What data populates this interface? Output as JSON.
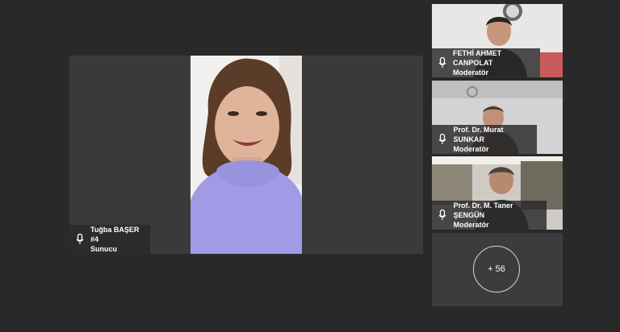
{
  "main_speaker": {
    "name": "Tuğba BAŞER #4",
    "role": "Sunucu"
  },
  "participants": [
    {
      "name": "FETHİ AHMET CANPOLAT",
      "role": "Moderatör"
    },
    {
      "name": "Prof. Dr. Murat SUNKAR",
      "role": "Moderatör"
    },
    {
      "name": "Prof. Dr. M. Taner ŞENGÜN",
      "role": "Moderatör"
    }
  ],
  "more_participants": "+ 56",
  "icons": {
    "mic": "microphone-icon"
  },
  "colors": {
    "background": "#292929",
    "tile": "#3a3a3a",
    "text": "#ffffff"
  }
}
